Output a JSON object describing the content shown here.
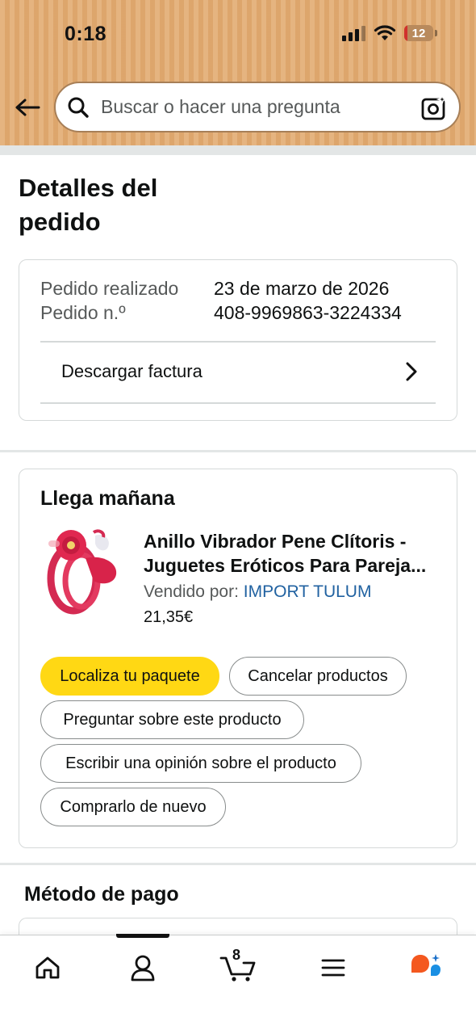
{
  "status_bar": {
    "time": "0:18",
    "battery_level": "12",
    "battery_fraction": 0.12
  },
  "header": {
    "back_icon": "back-arrow-icon",
    "search": {
      "placeholder": "Buscar o hacer una pregunta",
      "search_icon": "search-icon",
      "camera_icon": "camera-scan-icon"
    }
  },
  "page": {
    "title": "Detalles del pedido"
  },
  "order_info": {
    "placed_label": "Pedido realizado",
    "placed_value": "23 de marzo de 2026",
    "number_label": "Pedido n.º",
    "number_value": "408-9969863-3224334",
    "invoice_link": "Descargar factura"
  },
  "shipment": {
    "status": "Llega mañana",
    "product": {
      "title": "Anillo Vibrador Pene Clítoris - Juguetes Eróticos Para Pareja...",
      "sold_by_label": "Vendido por:",
      "seller": "IMPORT TULUM",
      "price": "21,35€"
    },
    "actions": {
      "track": "Localiza tu paquete",
      "cancel": "Cancelar productos",
      "ask": "Preguntar sobre este producto",
      "review": "Escribir una opinión sobre el producto",
      "buy_again": "Comprarlo de nuevo"
    }
  },
  "payment": {
    "title": "Método de pago"
  },
  "bottom_nav": {
    "items": [
      "home-icon",
      "account-icon",
      "cart-icon",
      "menu-icon",
      "rufus-icon"
    ],
    "cart_count": "8"
  },
  "colors": {
    "header_bg": "#e2ab72",
    "primary_button": "#ffd814",
    "link": "#2162a1"
  }
}
